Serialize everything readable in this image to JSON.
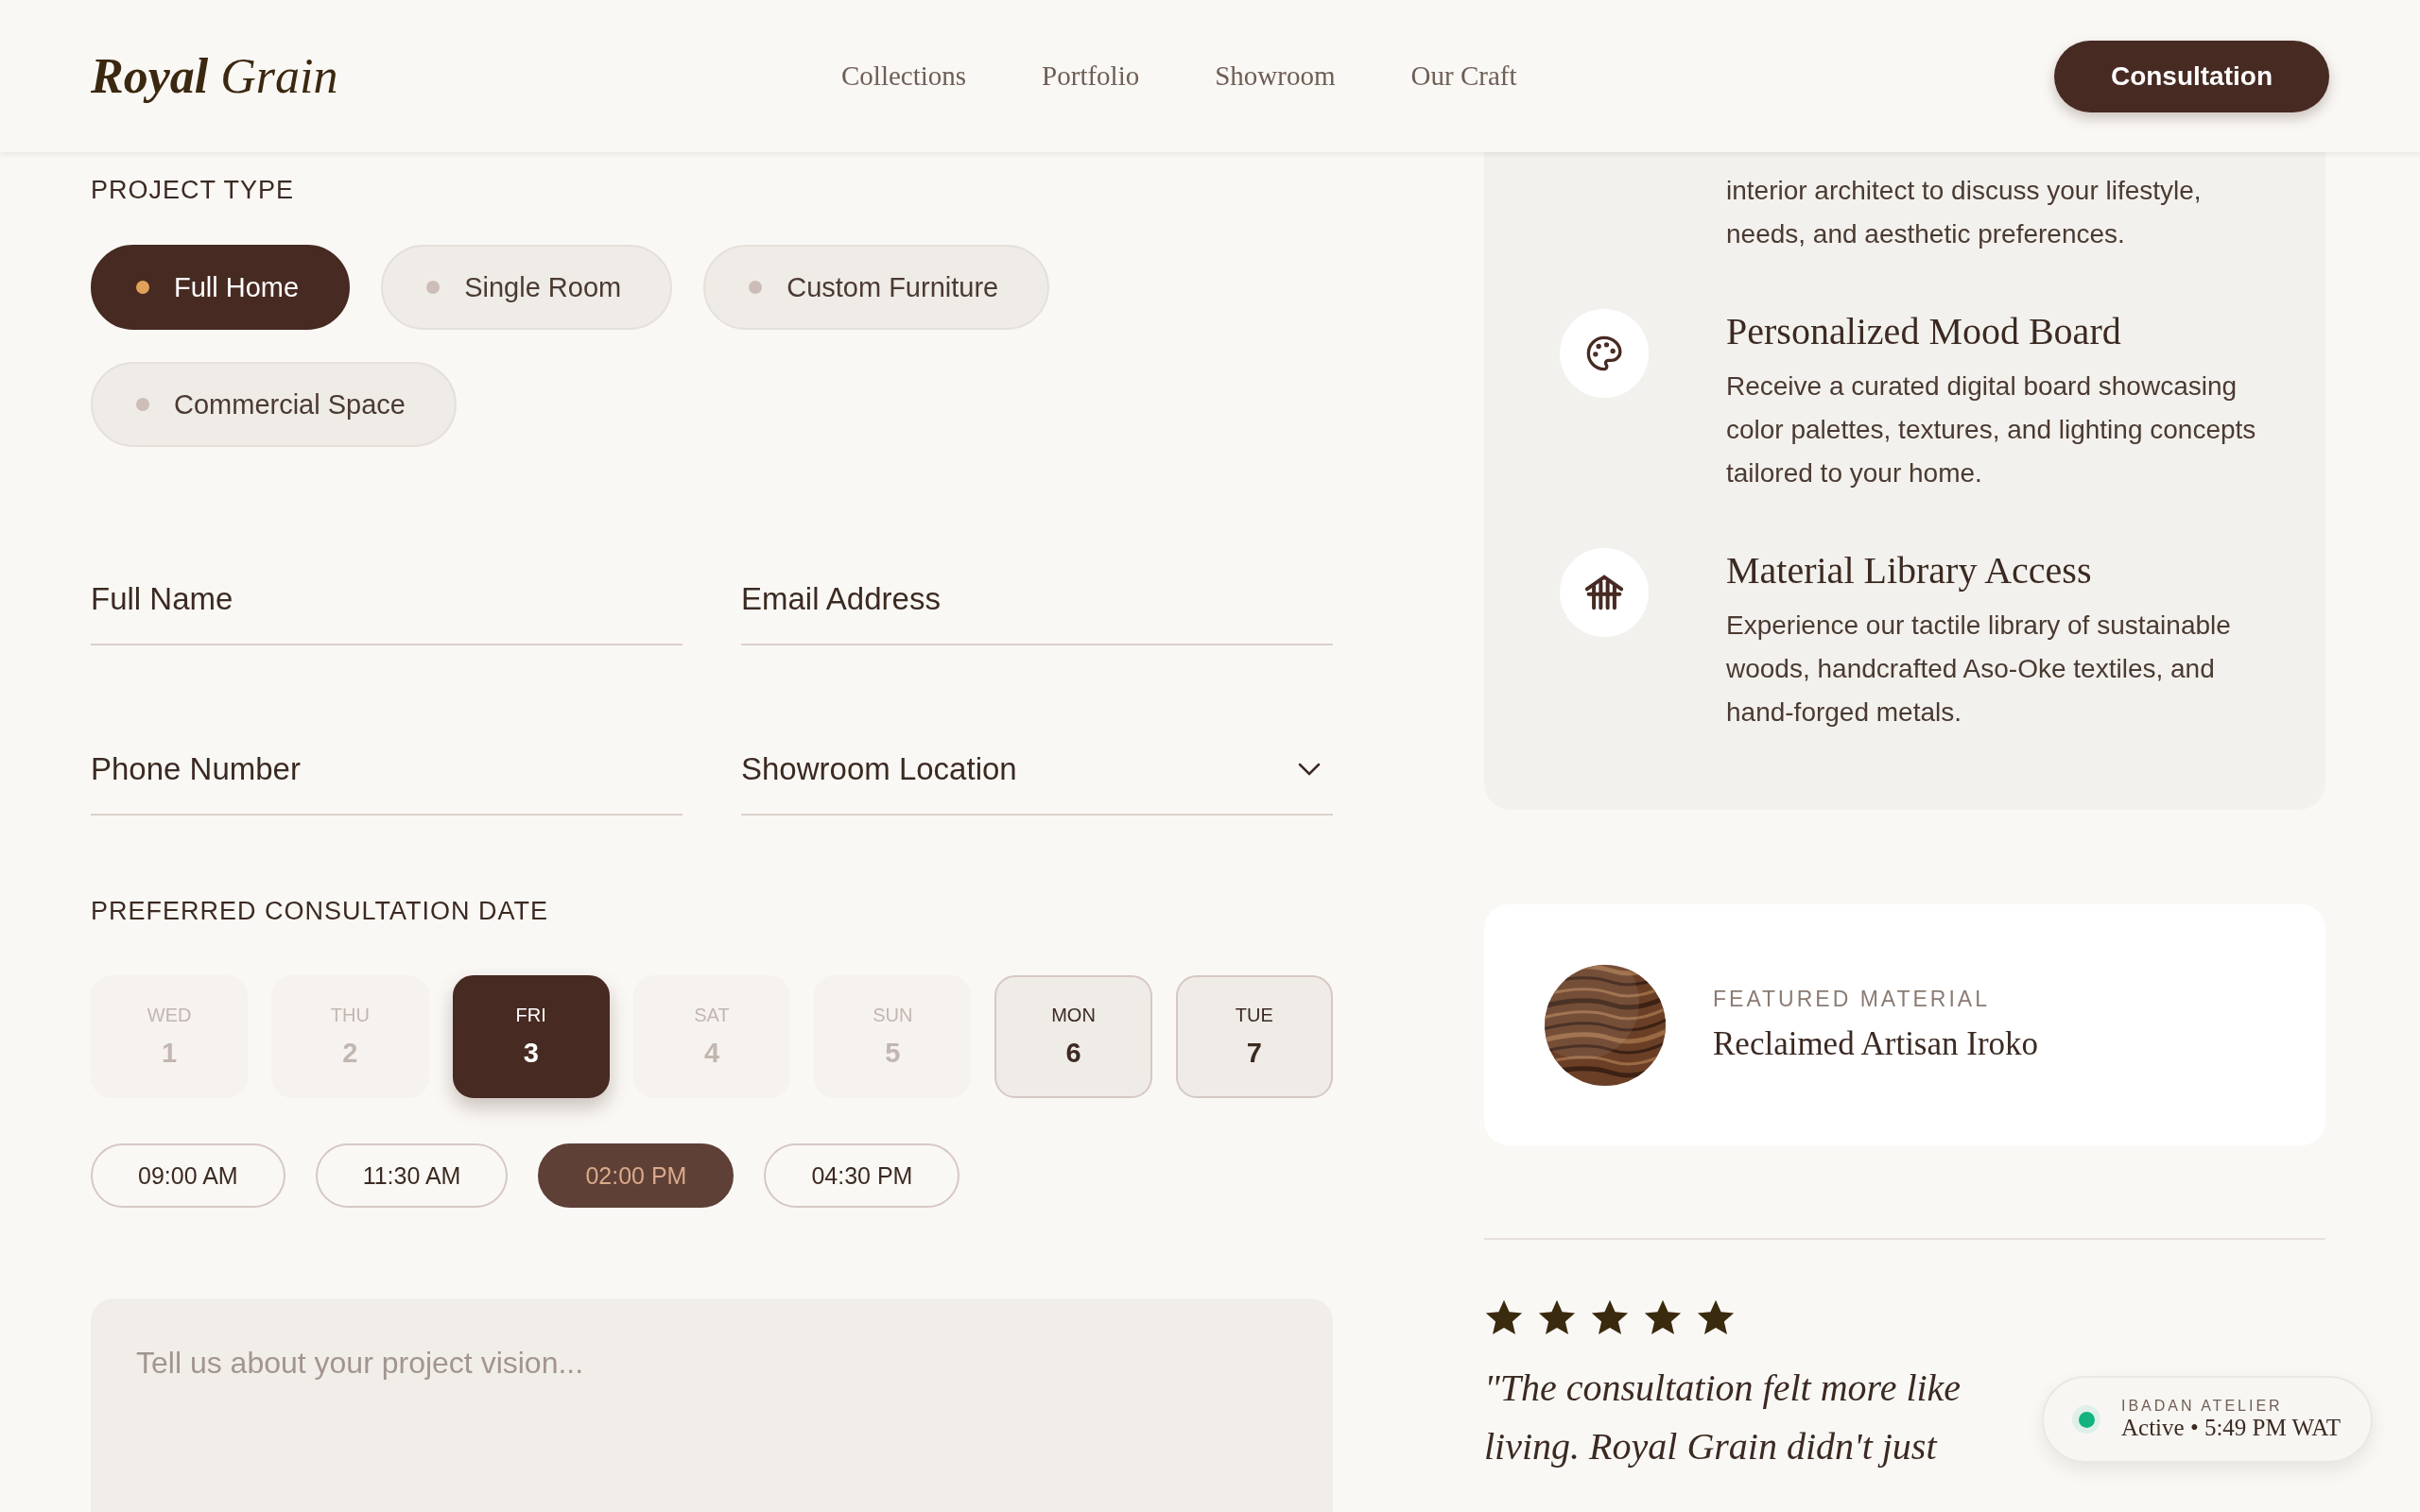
{
  "header": {
    "logo_bold": "Royal",
    "logo_light": "Grain",
    "nav": [
      "Collections",
      "Portfolio",
      "Showroom",
      "Our Craft"
    ],
    "cta": "Consultation"
  },
  "form": {
    "project_type_label": "PROJECT TYPE",
    "project_types": [
      {
        "label": "Full Home",
        "selected": true
      },
      {
        "label": "Single Room",
        "selected": false
      },
      {
        "label": "Custom Furniture",
        "selected": false
      },
      {
        "label": "Commercial Space",
        "selected": false
      }
    ],
    "fields": [
      {
        "kind": "text",
        "placeholder": "Full Name"
      },
      {
        "kind": "text",
        "placeholder": "Email Address"
      },
      {
        "kind": "text",
        "placeholder": "Phone Number"
      },
      {
        "kind": "select",
        "placeholder": "Showroom Location"
      }
    ],
    "date_label": "PREFERRED CONSULTATION DATE",
    "dates": [
      {
        "day": "WED",
        "date": "1",
        "selected": false,
        "disabled": true
      },
      {
        "day": "THU",
        "date": "2",
        "selected": false,
        "disabled": true
      },
      {
        "day": "FRI",
        "date": "3",
        "selected": true,
        "disabled": false
      },
      {
        "day": "SAT",
        "date": "4",
        "selected": false,
        "disabled": true
      },
      {
        "day": "SUN",
        "date": "5",
        "selected": false,
        "disabled": true
      },
      {
        "day": "MON",
        "date": "6",
        "selected": false,
        "disabled": false
      },
      {
        "day": "TUE",
        "date": "7",
        "selected": false,
        "disabled": false
      }
    ],
    "times": [
      {
        "label": "09:00 AM",
        "selected": false
      },
      {
        "label": "11:30 AM",
        "selected": false
      },
      {
        "label": "02:00 PM",
        "selected": true
      },
      {
        "label": "04:30 PM",
        "selected": false
      }
    ],
    "message": {
      "placeholder": "Tell us about your project vision..."
    }
  },
  "benefits": [
    {
      "kind": "none",
      "description": "interior architect to discuss your lifestyle, needs, and aesthetic preferences."
    },
    {
      "kind": "palette",
      "title": "Personalized Mood Board",
      "description": "Receive a curated digital board showcasing color palettes, textures, and lighting concepts tailored to your home."
    },
    {
      "kind": "library",
      "title": "Material Library Access",
      "description": "Experience our tactile library of sustainable woods, handcrafted Aso-Oke textiles, and hand-forged metals."
    }
  ],
  "featured": {
    "label": "FEATURED MATERIAL",
    "name": "Reclaimed Artisan Iroko"
  },
  "testimonial": {
    "stars": 5,
    "lines": [
      "\"The consultation felt more like",
      "living. Royal Grain didn't just"
    ]
  },
  "status": {
    "label": "IBADAN ATELIER",
    "state": "Active",
    "separator": "•",
    "time": "5:49 PM WAT"
  }
}
